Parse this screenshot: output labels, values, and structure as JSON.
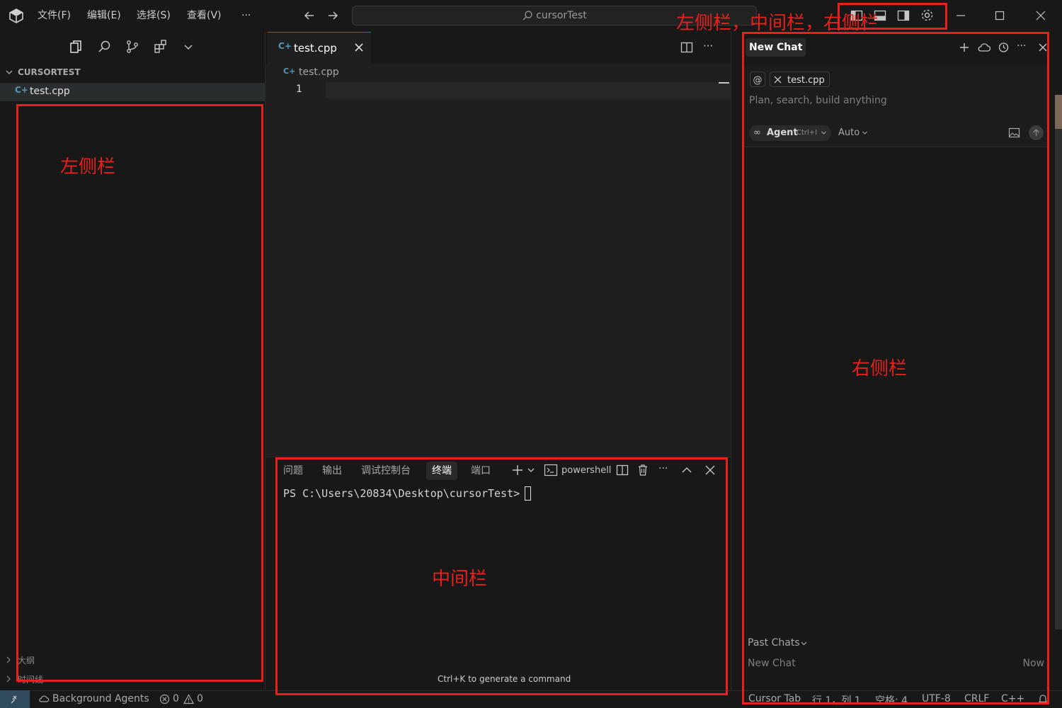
{
  "menu": [
    "文件(F)",
    "编辑(E)",
    "选择(S)",
    "查看(V)"
  ],
  "more_glyph": "···",
  "command_center": {
    "label": "cursorTest"
  },
  "sidebar": {
    "section_title": "CURSORTEST",
    "files": [
      {
        "name": "test.cpp"
      }
    ],
    "bottom_sections": [
      "大纲",
      "时间线"
    ]
  },
  "editor": {
    "tab_label": "test.cpp",
    "breadcrumb": "test.cpp",
    "line_numbers": [
      "1"
    ]
  },
  "panel": {
    "tabs": [
      "问题",
      "输出",
      "调试控制台",
      "终端",
      "端口"
    ],
    "active_tab": "终端",
    "shell_name": "powershell",
    "prompt": "PS C:\\Users\\20834\\Desktop\\cursorTest>",
    "hint": "Ctrl+K to generate a command"
  },
  "chat": {
    "tab_title": "New Chat",
    "at_symbol": "@",
    "context_file": "test.cpp",
    "placeholder": "Plan, search, build anything",
    "mode_label": "Agent",
    "mode_shortcut": "Ctrl+I",
    "model_label": "Auto",
    "past_chats_label": "Past Chats",
    "past_chats": [
      {
        "title": "New Chat",
        "time": "Now"
      }
    ]
  },
  "statusbar": {
    "background_agents": "Background Agents",
    "errors": "0",
    "warnings": "0",
    "items": [
      "Cursor Tab",
      "行 1，列 1",
      "空格: 4",
      "UTF-8",
      "CRLF",
      "C++"
    ]
  },
  "annotations": {
    "top_label": "左侧栏，中间栏，右侧栏",
    "left_label": "左侧栏",
    "middle_label": "中间栏",
    "right_label": "右侧栏"
  },
  "colors": {
    "accent": "#0078d4",
    "annotation_red": "#e8201c",
    "cpp_icon": "#519aba"
  }
}
